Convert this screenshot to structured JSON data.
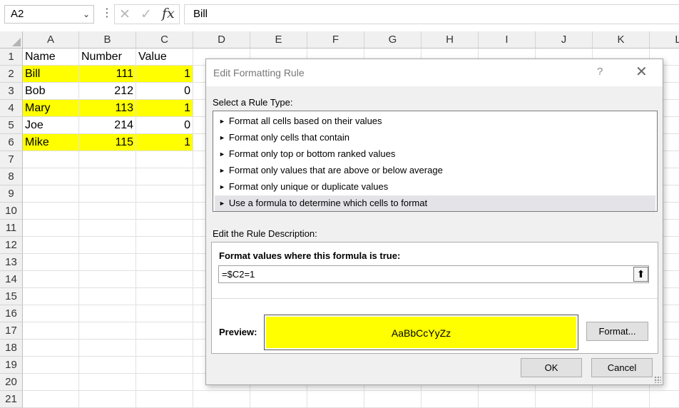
{
  "formula_bar": {
    "name_box": "A2",
    "cancel_icon": "✕",
    "enter_icon": "✓",
    "fx_label": "fx",
    "formula": "Bill"
  },
  "columns": [
    "A",
    "B",
    "C",
    "D",
    "E",
    "F",
    "G",
    "H",
    "I",
    "J",
    "K",
    "L"
  ],
  "rows": [
    "1",
    "2",
    "3",
    "4",
    "5",
    "6",
    "7",
    "8",
    "9",
    "10",
    "11",
    "12",
    "13",
    "14",
    "15",
    "16",
    "17",
    "18",
    "19",
    "20",
    "21"
  ],
  "cells": {
    "header": [
      "Name",
      "Number",
      "Value"
    ],
    "data": [
      {
        "name": "Bill",
        "number": "111",
        "value": "1",
        "highlight": true
      },
      {
        "name": "Bob",
        "number": "212",
        "value": "0",
        "highlight": false
      },
      {
        "name": "Mary",
        "number": "113",
        "value": "1",
        "highlight": true
      },
      {
        "name": "Joe",
        "number": "214",
        "value": "0",
        "highlight": false
      },
      {
        "name": "Mike",
        "number": "115",
        "value": "1",
        "highlight": true
      }
    ],
    "highlight_color": "#ffff00"
  },
  "dialog": {
    "title": "Edit Formatting Rule",
    "help": "?",
    "close": "✕",
    "select_rule_label": "Select a Rule Type:",
    "rule_types": [
      "Format all cells based on their values",
      "Format only cells that contain",
      "Format only top or bottom ranked values",
      "Format only values that are above or below average",
      "Format only unique or duplicate values",
      "Use a formula to determine which cells to format"
    ],
    "selected_rule_index": 5,
    "edit_desc_label": "Edit the Rule Description:",
    "formula_label": "Format values where this formula is true:",
    "formula_value": "=$C2=1",
    "collapse_icon": "⬆",
    "preview_label": "Preview:",
    "preview_text": "AaBbCcYyZz",
    "format_button": "Format...",
    "ok_button": "OK",
    "cancel_button": "Cancel"
  }
}
